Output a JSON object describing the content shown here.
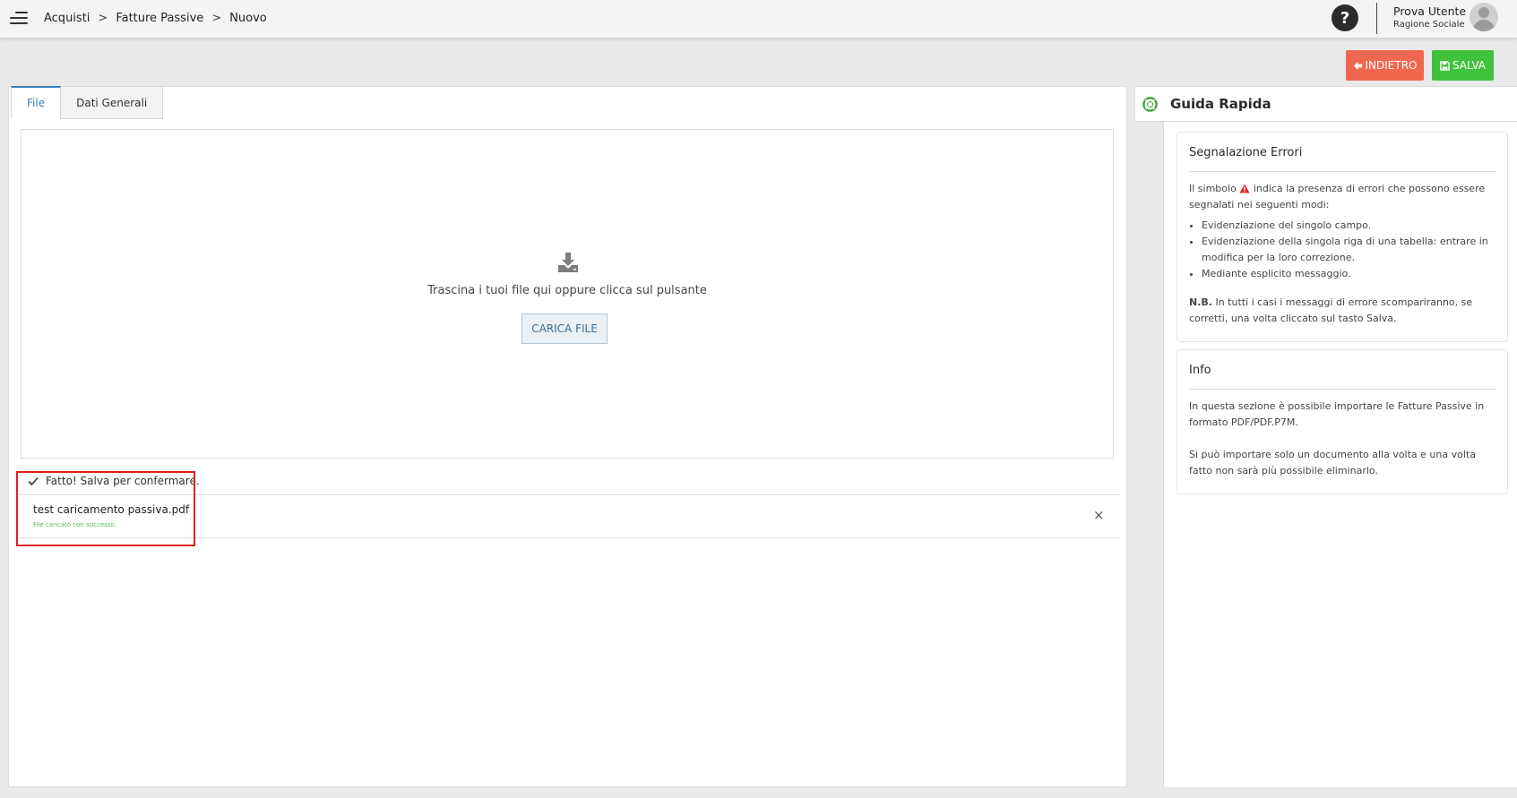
{
  "header": {
    "breadcrumb": [
      "Acquisti",
      "Fatture Passive",
      "Nuovo"
    ],
    "separator": ">",
    "help_label": "?",
    "user_name": "Prova Utente",
    "user_org": "Ragione Sociale"
  },
  "actions": {
    "back_label": "INDIETRO",
    "save_label": "SALVA",
    "back_color": "#f0674f",
    "save_color": "#41c23c"
  },
  "tabs": [
    {
      "label": "File",
      "active": true
    },
    {
      "label": "Dati Generali",
      "active": false
    }
  ],
  "dropzone": {
    "icon": "download-icon",
    "text": "Trascina i tuoi file qui oppure clicca sul pulsante",
    "button_label": "CARICA FILE"
  },
  "upload": {
    "status_text": "Fatto! Salva per confermare.",
    "file_name": "test caricamento passiva.pdf",
    "file_message": "File caricato con successo.",
    "remove_label": "×"
  },
  "guide": {
    "title": "Guida Rapida",
    "errors_card": {
      "title": "Segnalazione Errori",
      "intro_before": "Il simbolo",
      "intro_after": "indica la presenza di errori che possono essere segnalati nei seguenti modi:",
      "items": [
        "Evidenziazione del singolo campo.",
        "Evidenziazione della singola riga di una tabella: entrare in modifica per la loro correzione.",
        "Mediante esplicito messaggio."
      ],
      "nb_label": "N.B.",
      "nb_text": "In tutti i casi i messaggi di errore scompariranno, se corretti, una volta cliccato sul tasto Salva."
    },
    "info_card": {
      "title": "Info",
      "paragraph1": "In questa sezione è possibile importare le Fatture Passive in formato PDF/PDF.P7M.",
      "paragraph2": "Si può importare solo un documento alla volta e una volta fatto non sarà più possibile eliminarlo."
    }
  }
}
